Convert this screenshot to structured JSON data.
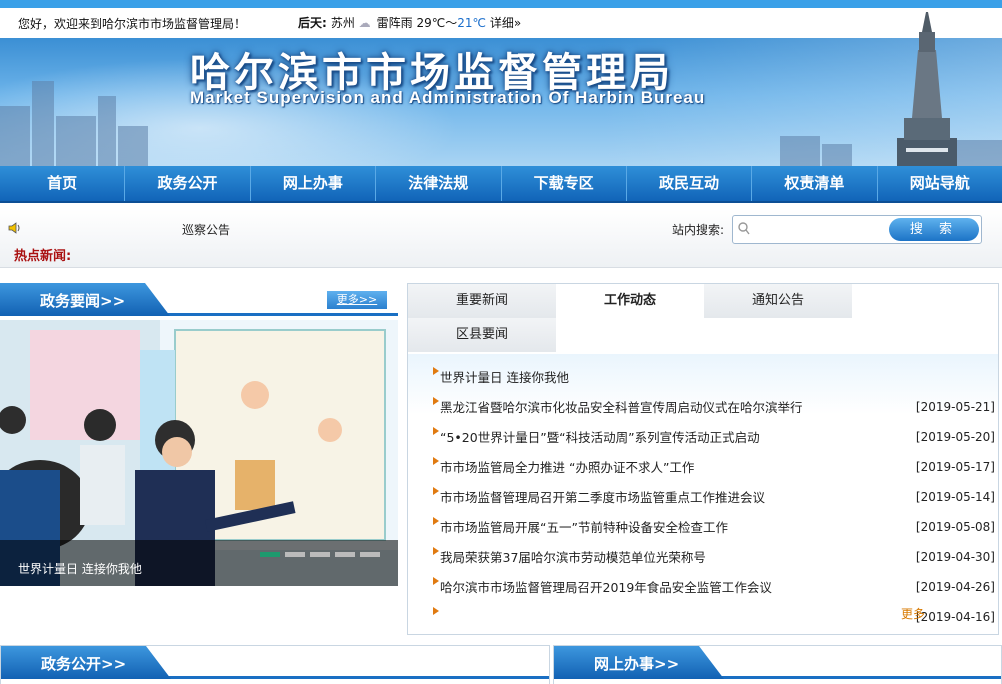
{
  "topbar": {
    "welcome": "您好，欢迎来到哈尔滨市市场监督管理局！",
    "weather_day": "后天:",
    "weather_city": "苏州",
    "weather_desc": "雷阵雨",
    "weather_low": "29℃～",
    "weather_high": "21℃",
    "weather_detail": "详细»"
  },
  "banner": {
    "title_cn": "哈尔滨市市场监督管理局",
    "title_en": "Market Supervision and Administration Of Harbin Bureau"
  },
  "nav": {
    "items": [
      {
        "label": "首页"
      },
      {
        "label": "政务公开"
      },
      {
        "label": "网上办事"
      },
      {
        "label": "法律法规"
      },
      {
        "label": "下载专区"
      },
      {
        "label": "政民互动"
      },
      {
        "label": "权责清单"
      },
      {
        "label": "网站导航"
      }
    ]
  },
  "infobar": {
    "notice": "巡察公告",
    "hot_news_label": "热点新闻:",
    "search_label": "站内搜索:",
    "search_value": "",
    "search_button": "搜 索"
  },
  "left_section": {
    "title": "政务要闻>>",
    "more": "更多>>",
    "photo_caption": "世界计量日 连接你我他",
    "slides": 5,
    "active_slide": 1
  },
  "right_section": {
    "tabs": [
      {
        "label": "重要新闻",
        "active": false
      },
      {
        "label": "工作动态",
        "active": true
      },
      {
        "label": "通知公告",
        "active": false
      },
      {
        "label": "区县要闻",
        "active": false
      }
    ],
    "items": [
      {
        "title": "世界计量日 连接你我他",
        "date": ""
      },
      {
        "title": "黑龙江省暨哈尔滨市化妆品安全科普宣传周启动仪式在哈尔滨举行",
        "date": "[2019-05-21]"
      },
      {
        "title": "“5•20世界计量日”暨“科技活动周”系列宣传活动正式启动",
        "date": "[2019-05-20]"
      },
      {
        "title": "市市场监管局全力推进 “办照办证不求人”工作",
        "date": "[2019-05-17]"
      },
      {
        "title": "市市场监督管理局召开第二季度市场监管重点工作推进会议",
        "date": "[2019-05-14]"
      },
      {
        "title": "市市场监管局开展“五一”节前特种设备安全检查工作",
        "date": "[2019-05-08]"
      },
      {
        "title": "我局荣获第37届哈尔滨市劳动模范单位光荣称号",
        "date": "[2019-04-30]"
      },
      {
        "title": "哈尔滨市市场监督管理局召开2019年食品安全监管工作会议",
        "date": "[2019-04-26]"
      },
      {
        "title": "",
        "date": "[2019-04-16]"
      }
    ],
    "more": "更多"
  },
  "bottom": {
    "left_title": "政务公开>>",
    "right_title": "网上办事>>"
  },
  "colors": {
    "nav_blue": "#1a72c4",
    "hot_red": "#aa1111",
    "accent_orange": "#e07a10"
  }
}
